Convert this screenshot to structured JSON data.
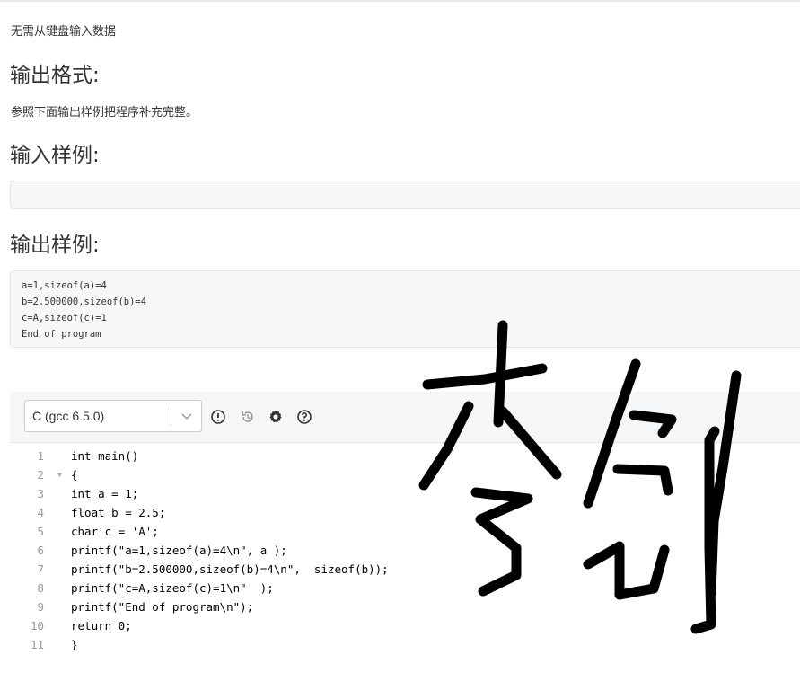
{
  "input_desc": "无需从键盘输入数据",
  "output_format_heading": "输出格式:",
  "output_format_text": "参照下面输出样例把程序补充完整。",
  "input_sample_heading": "输入样例:",
  "input_sample_lines": [],
  "output_sample_heading": "输出样例:",
  "output_sample_lines": [
    "a=1,sizeof(a)=4",
    "b=2.500000,sizeof(b)=4",
    "c=A,sizeof(c)=1",
    "End of program"
  ],
  "editor": {
    "language": "C (gcc 6.5.0)",
    "icons": [
      "alert-icon",
      "history-icon",
      "settings-icon",
      "help-icon"
    ],
    "line_numbers": [
      "1",
      "2",
      "3",
      "4",
      "5",
      "6",
      "7",
      "8",
      "9",
      "10",
      "11"
    ],
    "lines": [
      "int main()",
      "{",
      "int a = 1;",
      "float b = 2.5;",
      "char c = 'A';",
      "printf(\"a=1,sizeof(a)=4\\n\", a );",
      "printf(\"b=2.500000,sizeof(b)=4\\n\",  sizeof(b));",
      "printf(\"c=A,sizeof(c)=1\\n\"  );",
      "printf(\"End of program\\n\");",
      "return 0;",
      "}"
    ]
  },
  "colors": {
    "keyword_purple": "#6d3ab3",
    "keyword_red": "#a3154a",
    "number_green": "#116644",
    "toolbar_bg": "#f5f6f7",
    "sample_bg": "#f7f7f7"
  }
}
